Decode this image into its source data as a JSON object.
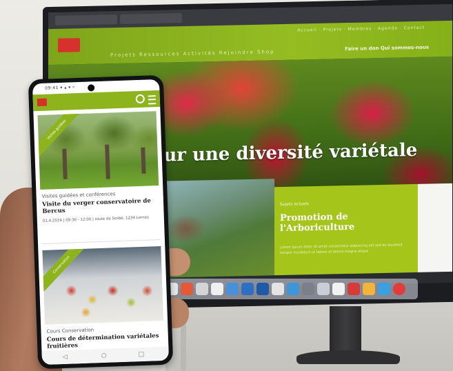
{
  "monitor": {
    "site_top_nav": "Accueil · Projets · Membres · Agenda · Contact",
    "site_nav": "Projets  Ressources  Activités  Rejoindre  Shop",
    "site_search": "Faire un don   Qui sommes-nous",
    "hero_title": "our une diversité variétale",
    "card_kicker": "Sujets actuels",
    "card_title": "Promotion de l'Arboriculture",
    "card_text": "Lorem ipsum dolor sit amet consectetur adipiscing elit sed do eiusmod tempor incididunt ut labore et dolore magna aliqua"
  },
  "phone": {
    "status_text": "09:41 ▾ ▴ ▾ ▿",
    "card1": {
      "ribbon": "Visites guidées",
      "category": "Visites guidées et conférences",
      "title": "Visite du verger conservatoire de Bercus",
      "date": "01.4.2019 | 09:30 - 12:00 | route de Sorbé, 1234 Lernes"
    },
    "card2": {
      "ribbon": "Conservation",
      "category": "Cours Conservation",
      "title": "Cours de détermination variétales fruitières"
    }
  },
  "colors": {
    "brand_green": "#8db41c",
    "brand_red": "#d5312a"
  }
}
